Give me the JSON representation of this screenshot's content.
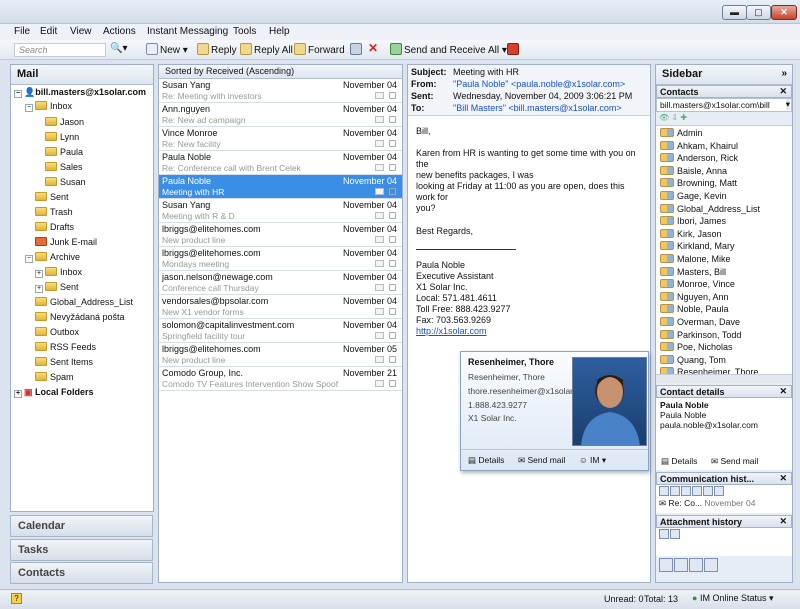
{
  "window": {
    "min": "▬",
    "max": "▢",
    "close": "✕"
  },
  "menu": [
    "File",
    "Edit",
    "View",
    "Actions",
    "Instant Messaging",
    "Tools",
    "Help"
  ],
  "toolbar": {
    "search_placeholder": "Search",
    "new": "New",
    "reply": "Reply",
    "reply_all": "Reply All",
    "forward": "Forward",
    "send_receive": "Send and Receive All"
  },
  "mail": {
    "title": "Mail",
    "account": "bill.masters@x1solar.com",
    "inbox": "Inbox",
    "inbox_sub": [
      "Jason",
      "Lynn",
      "Paula",
      "Sales",
      "Susan"
    ],
    "folders": [
      "Sent",
      "Trash",
      "Drafts",
      "Junk E-mail"
    ],
    "archive": "Archive",
    "archive_sub": [
      "Inbox",
      "Sent",
      "Global_Address_List",
      "Nevyžádaná pošta",
      "Outbox",
      "RSS Feeds",
      "Sent Items",
      "Spam"
    ],
    "local": "Local Folders"
  },
  "nav": {
    "calendar": "Calendar",
    "tasks": "Tasks",
    "contacts": "Contacts"
  },
  "list": {
    "sort": "Sorted by Received (Ascending)",
    "messages": [
      {
        "from": "Susan Yang",
        "date": "November 04",
        "subject": "Re: Meeting with investors"
      },
      {
        "from": "Ann.nguyen",
        "date": "November 04",
        "subject": "Re: New ad campaign"
      },
      {
        "from": "Vince Monroe",
        "date": "November 04",
        "subject": "Re: New facility"
      },
      {
        "from": "Paula Noble",
        "date": "November 04",
        "subject": "Re: Conference call with Brent Celek"
      },
      {
        "from": "Paula Noble",
        "date": "November 04",
        "subject": "Meeting with HR"
      },
      {
        "from": "Susan Yang",
        "date": "November 04",
        "subject": "Meeting with R & D"
      },
      {
        "from": "lbriggs@elitehomes.com",
        "date": "November 04",
        "subject": "New product line"
      },
      {
        "from": "lbriggs@elitehomes.com",
        "date": "November 04",
        "subject": "Mondays meeting"
      },
      {
        "from": "jason.nelson@newage.com",
        "date": "November 04",
        "subject": "Conference call Thursday"
      },
      {
        "from": "vendorsales@bpsolar.com",
        "date": "November 04",
        "subject": "New X1 vendor forms"
      },
      {
        "from": "solomon@capitalinvestment.com",
        "date": "November 04",
        "subject": "Springfield facility tour"
      },
      {
        "from": "lbriggs@elitehomes.com",
        "date": "November 05",
        "subject": "New product line"
      },
      {
        "from": "Comodo Group, Inc.",
        "date": "November 21",
        "subject": "Comodo TV Features Intervention Show Spoof"
      }
    ]
  },
  "reading": {
    "subject_lbl": "Subject:",
    "subject": "Meeting with HR",
    "from_lbl": "From:",
    "from_name": "\"Paula Noble\"",
    "from_email": "<paula.noble@x1solar.com>",
    "sent_lbl": "Sent:",
    "sent": "Wednesday, November 04, 2009 3:06:21 PM",
    "to_lbl": "To:",
    "to_name": "\"Bill Masters\"",
    "to_email": "<bill.masters@x1solar.com>",
    "greeting": "Bill,",
    "p1a": "Karen from HR is wanting to get some time with you on the",
    "p1b": "new benefits packages, I was",
    "p1c": "looking at Friday at 11:00 as you are open, does this work for",
    "p1d": "you?",
    "regards": "Best Regards,",
    "sig": [
      "Paula Noble",
      "Executive Assistant",
      "X1 Solar Inc.",
      "Local: 571.481.4611",
      "Toll Free: 888.423.9277",
      "Fax: 703.563.9269"
    ],
    "link": "http://x1solar.com"
  },
  "card": {
    "title": "Resenheimer, Thore",
    "name": "Resenheimer, Thore",
    "email": "thore.resenheimer@x1solar.com",
    "phone": "1.888.423.9277",
    "company": "X1 Solar Inc.",
    "details": "Details",
    "send_mail": "Send mail",
    "im": "IM"
  },
  "sidebar": {
    "title": "Sidebar",
    "contacts_title": "Contacts",
    "account": "bill.masters@x1solar.com\\bill",
    "contacts": [
      "Admin",
      "Ahkam, Khairul",
      "Anderson, Rick",
      "Baisle, Anna",
      "Browning, Matt",
      "Gage, Kevin",
      "Global_Address_List",
      "Ibori, James",
      "Kirk, Jason",
      "Kirkland, Mary",
      "Malone, Mike",
      "Masters, Bill",
      "Monroe, Vince",
      "Nguyen, Ann",
      "Noble, Paula",
      "Overman, Dave",
      "Parkinson, Todd",
      "Poe, Nicholas",
      "Quang, Tom",
      "Resenheimer, Thore"
    ],
    "details_title": "Contact details",
    "d_name": "Paula Noble",
    "d_first": "Paula Noble",
    "d_email": "paula.noble@x1solar.com",
    "details_btn": "Details",
    "send_mail": "Send mail",
    "comm_title": "Communication hist...",
    "comm_item": "Re: Co...",
    "comm_date": "November 04",
    "attach_title": "Attachment history"
  },
  "status": {
    "unread": "Unread: 0",
    "total": "Total: 13",
    "im": "IM Online Status"
  }
}
